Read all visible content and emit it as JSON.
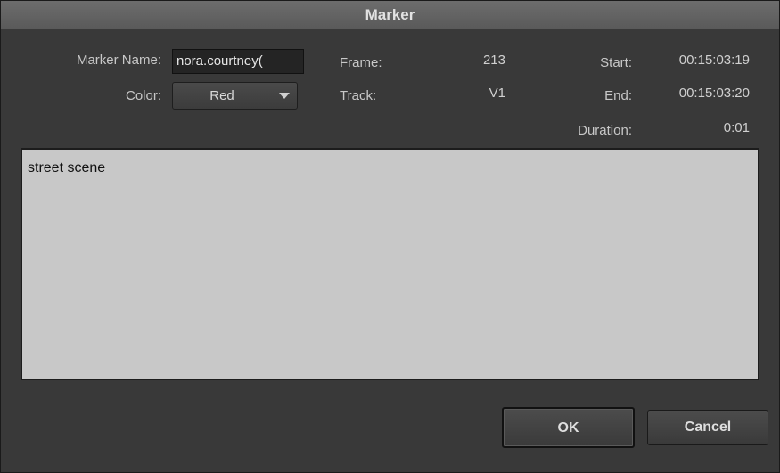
{
  "dialog": {
    "title": "Marker"
  },
  "fields": {
    "marker_name_label": "Marker Name:",
    "marker_name_value": "nora.courtney(",
    "color_label": "Color:",
    "color_value": "Red",
    "frame_label": "Frame:",
    "frame_value": "213",
    "track_label": "Track:",
    "track_value": "V1",
    "start_label": "Start:",
    "start_value": "00:15:03:19",
    "end_label": "End:",
    "end_value": "00:15:03:20",
    "duration_label": "Duration:",
    "duration_value": "0:01"
  },
  "comment": {
    "text": "street scene"
  },
  "buttons": {
    "ok": "OK",
    "cancel": "Cancel"
  }
}
